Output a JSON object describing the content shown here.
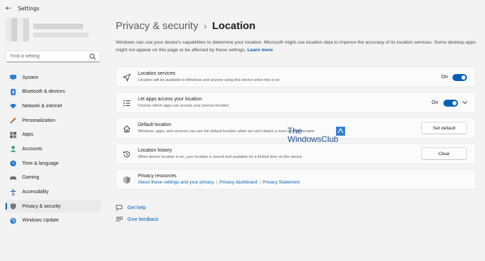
{
  "app": {
    "title": "Settings",
    "back_icon": "back-arrow-icon"
  },
  "search": {
    "placeholder": "Find a setting",
    "icon": "search-icon"
  },
  "sidebar": {
    "items": [
      {
        "label": "System",
        "icon": "monitor-icon",
        "active": false
      },
      {
        "label": "Bluetooth & devices",
        "icon": "bluetooth-icon",
        "active": false
      },
      {
        "label": "Network & internet",
        "icon": "wifi-icon",
        "active": false
      },
      {
        "label": "Personalization",
        "icon": "brush-icon",
        "active": false
      },
      {
        "label": "Apps",
        "icon": "apps-icon",
        "active": false
      },
      {
        "label": "Accounts",
        "icon": "person-icon",
        "active": false
      },
      {
        "label": "Time & language",
        "icon": "globe-clock-icon",
        "active": false
      },
      {
        "label": "Gaming",
        "icon": "gamepad-icon",
        "active": false
      },
      {
        "label": "Accessibility",
        "icon": "accessibility-icon",
        "active": false
      },
      {
        "label": "Privacy & security",
        "icon": "shield-icon",
        "active": true
      },
      {
        "label": "Windows Update",
        "icon": "update-icon",
        "active": false
      }
    ]
  },
  "breadcrumb": {
    "parent": "Privacy & security",
    "separator": "›",
    "current": "Location"
  },
  "description": {
    "text": "Windows can use your device's capabilities to determine your location. Microsoft might use location data to improve the accuracy of its location services. Some desktop apps might not appear on this page or be affected by these settings.",
    "link": "Learn more"
  },
  "cards": {
    "location_services": {
      "title": "Location services",
      "subtitle": "Location will be available to Windows and anyone using this device when this is on",
      "state": "On",
      "on": true
    },
    "apps_access": {
      "title": "Let apps access your location",
      "subtitle": "Choose which apps can access your precise location",
      "state": "On",
      "on": true
    },
    "default_location": {
      "title": "Default location",
      "subtitle": "Windows, apps, and services can use the default location when we can't detect a more precise location",
      "button": "Set default"
    },
    "location_history": {
      "title": "Location history",
      "subtitle": "When device location is on, your location is stored and available for a limited time on this device",
      "button": "Clear"
    },
    "privacy_resources": {
      "title": "Privacy resources",
      "links": [
        "About these settings and your privacy",
        "Privacy dashboard",
        "Privacy Statement"
      ]
    }
  },
  "help": {
    "get_help": "Get help",
    "give_feedback": "Give feedback"
  },
  "watermark": {
    "line1": "The",
    "line2": "WindowsClub"
  },
  "colors": {
    "accent": "#005fb8",
    "background": "#f3f3f3",
    "card": "#fbfbfb"
  }
}
